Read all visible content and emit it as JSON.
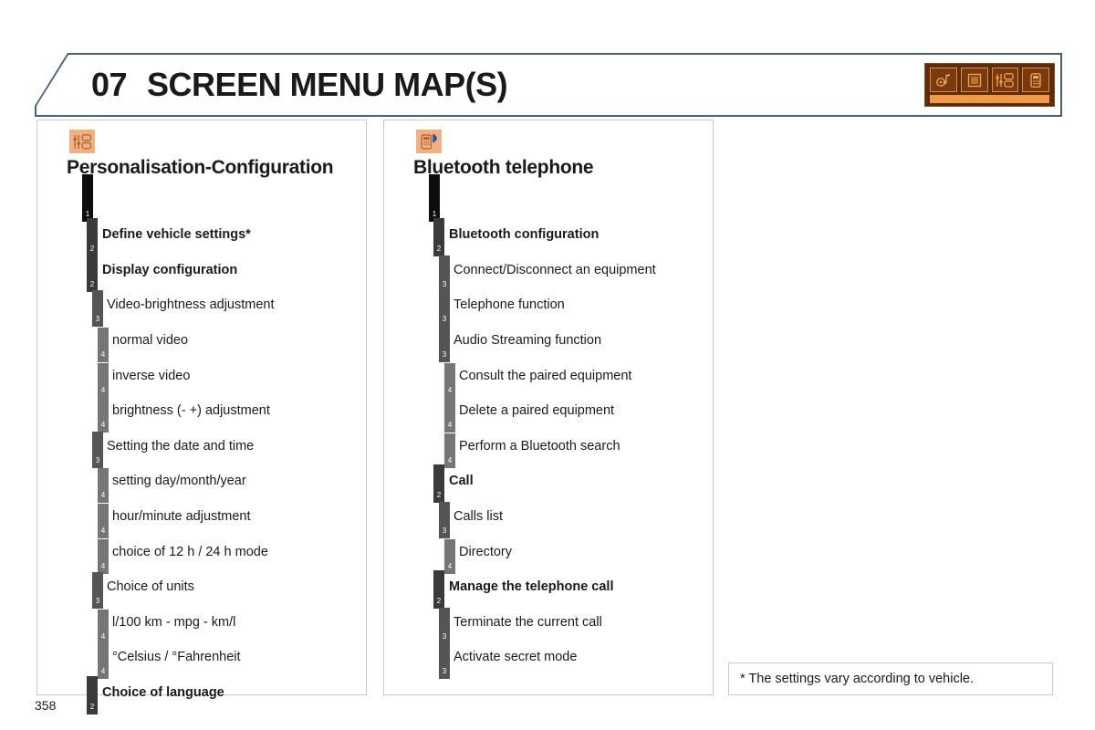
{
  "header": {
    "chapter_number": "07",
    "chapter_name": "SCREEN MENU MAP(S)",
    "icon_strip": {
      "name": "chapter-icon-strip",
      "tiles": [
        "media-audio-icon",
        "display-icon",
        "settings-sliders-icon",
        "telephone-icon"
      ],
      "bg_color": "#5d2c0c",
      "accent_color": "#f09a44"
    }
  },
  "panels": [
    {
      "id": "personalisation",
      "icon": "settings-sliders-icon",
      "title": "Personalisation-Configuration",
      "rows": [
        {
          "level": 1,
          "label": "Personalisation-Configuration",
          "bold": true,
          "title_row": true
        },
        {
          "level": 2,
          "label": "Define vehicle settings*",
          "bold": true
        },
        {
          "level": 2,
          "label": "Display configuration",
          "bold": true
        },
        {
          "level": 3,
          "label": "Video-brightness adjustment",
          "bold": false
        },
        {
          "level": 4,
          "label": "normal video",
          "bold": false
        },
        {
          "level": 4,
          "label": "inverse video",
          "bold": false
        },
        {
          "level": 4,
          "label": "brightness (- +) adjustment",
          "bold": false
        },
        {
          "level": 3,
          "label": "Setting the date and time",
          "bold": false
        },
        {
          "level": 4,
          "label": "setting day/month/year",
          "bold": false
        },
        {
          "level": 4,
          "label": "hour/minute adjustment",
          "bold": false
        },
        {
          "level": 4,
          "label": "choice of 12 h / 24 h mode",
          "bold": false
        },
        {
          "level": 3,
          "label": "Choice of units",
          "bold": false
        },
        {
          "level": 4,
          "label": "l/100 km - mpg - km/l",
          "bold": false
        },
        {
          "level": 4,
          "label": "°Celsius / °Fahrenheit",
          "bold": false
        },
        {
          "level": 2,
          "label": "Choice of language",
          "bold": true
        }
      ]
    },
    {
      "id": "bluetooth",
      "icon": "bluetooth-telephone-icon",
      "title": "Bluetooth telephone",
      "rows": [
        {
          "level": 1,
          "label": "Bluetooth telephone",
          "bold": true,
          "title_row": true
        },
        {
          "level": 2,
          "label": "Bluetooth configuration",
          "bold": true
        },
        {
          "level": 3,
          "label": "Connect/Disconnect an equipment",
          "bold": false
        },
        {
          "level": 3,
          "label": "Telephone function",
          "bold": false
        },
        {
          "level": 3,
          "label": "Audio Streaming function",
          "bold": false
        },
        {
          "level": 4,
          "label": "Consult the paired equipment",
          "bold": false
        },
        {
          "level": 4,
          "label": "Delete a paired equipment",
          "bold": false
        },
        {
          "level": 4,
          "label": "Perform a Bluetooth search",
          "bold": false
        },
        {
          "level": 2,
          "label": "Call",
          "bold": true
        },
        {
          "level": 3,
          "label": "Calls list",
          "bold": false
        },
        {
          "level": 4,
          "label": "Directory",
          "bold": false
        },
        {
          "level": 2,
          "label": "Manage the telephone call",
          "bold": true
        },
        {
          "level": 3,
          "label": "Terminate the current call",
          "bold": false
        },
        {
          "level": 3,
          "label": "Activate secret mode",
          "bold": false
        }
      ]
    }
  ],
  "footnote": {
    "text": "* The settings vary according to vehicle."
  },
  "page_number": "358",
  "colors": {
    "header_border": "#46607e",
    "panel_border": "#c9c9c9",
    "level1_marker": "#0d0d0d",
    "level2_marker": "#3a3a3a",
    "level3_marker": "#555555",
    "level4_marker": "#767676",
    "icon_badge_bg": "#f0b084",
    "text": "#1a1a1a"
  }
}
